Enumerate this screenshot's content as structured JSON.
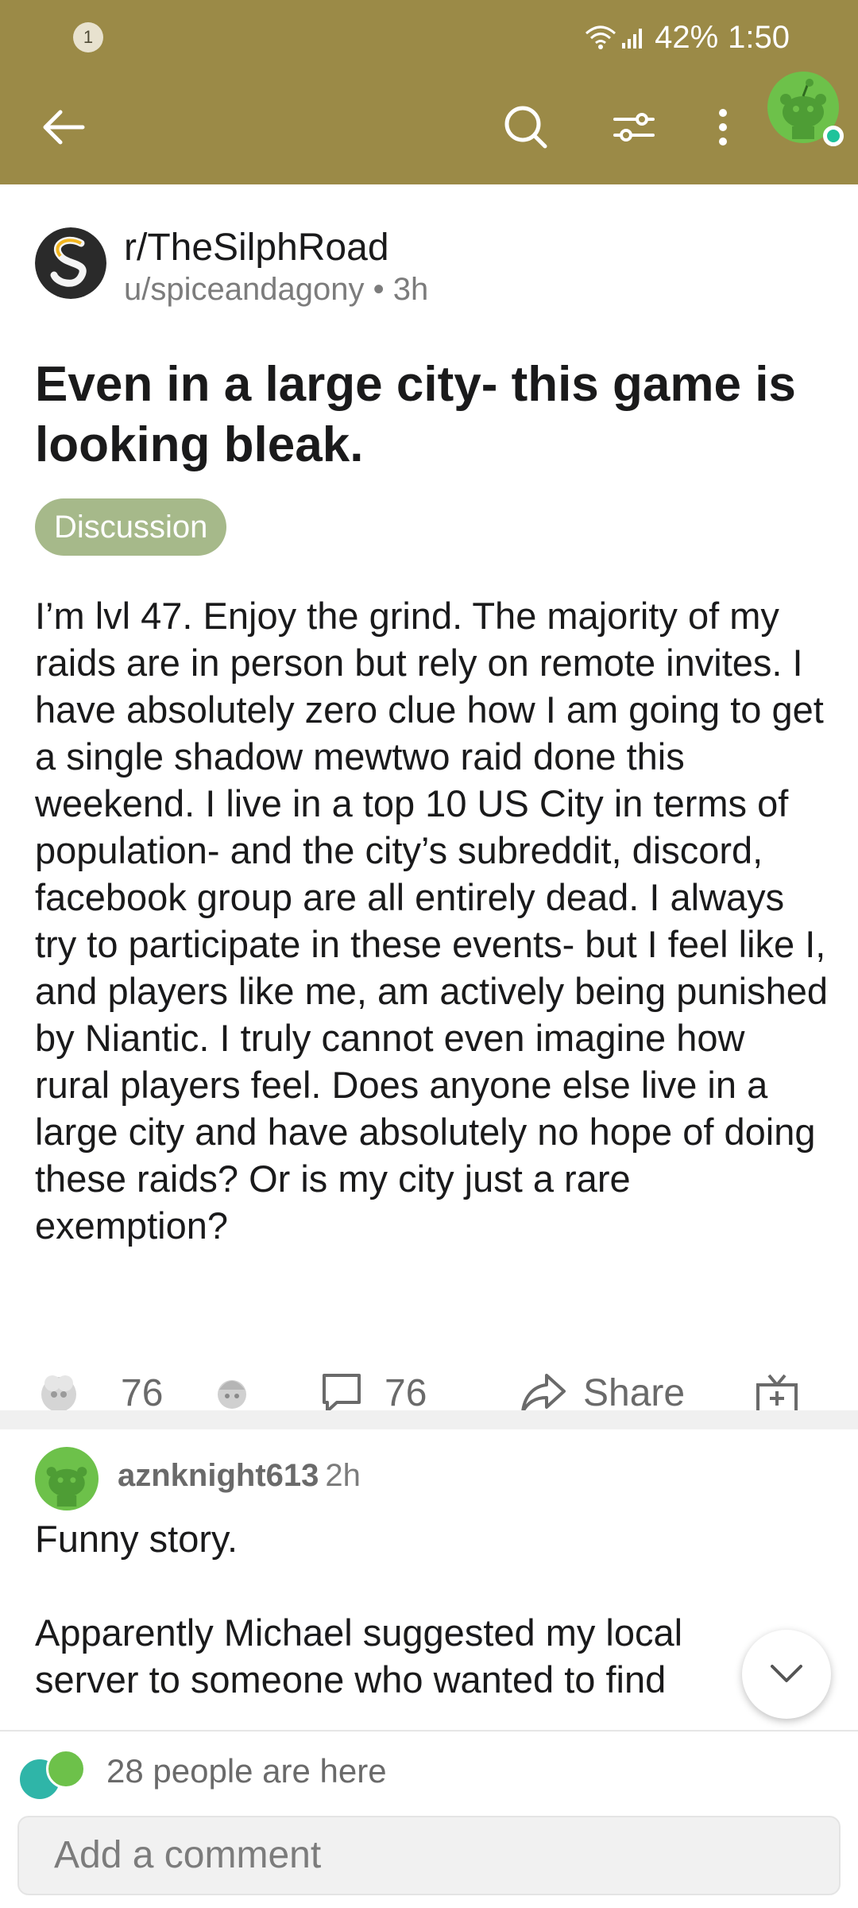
{
  "status_bar": {
    "notification_count": "1",
    "battery": "42%",
    "time": "1:50"
  },
  "header": {
    "icons": [
      "back-arrow-icon",
      "search-icon",
      "filter-icon",
      "more-vertical-icon",
      "user-avatar"
    ]
  },
  "post": {
    "subreddit": "r/TheSilphRoad",
    "author": "u/spiceandagony",
    "age": "3h",
    "title": "Even in a large city- this game is looking bleak.",
    "flair": "Discussion",
    "body": "I’m lvl 47. Enjoy the grind. The majority of my raids are in person but rely on remote invites. I have absolutely zero clue how I am going to get a single shadow mewtwo raid done this weekend. I live in a top 10 US City in terms of population- and the city’s subreddit, discord, facebook group are all entirely dead. I always try to participate in these events- but I feel like I, and players like me, am actively being punished by Niantic. I truly cannot even imagine how rural players feel. Does anyone else live in a large city and have absolutely no hope of doing these raids? Or is my city just a rare exemption?",
    "votes": "76",
    "comments": "76",
    "share_label": "Share"
  },
  "comment": {
    "author": "aznknight613",
    "age": "2h",
    "text": "Funny story.\n\nApparently Michael suggested my local server to someone who wanted to find"
  },
  "bottom": {
    "presence_text": "28 people are here",
    "input_placeholder": "Add a comment"
  },
  "colors": {
    "header": "#9b8a47",
    "flair": "#a6b98a",
    "avatar_green": "#6dc14a",
    "online": "#1fc39b"
  }
}
